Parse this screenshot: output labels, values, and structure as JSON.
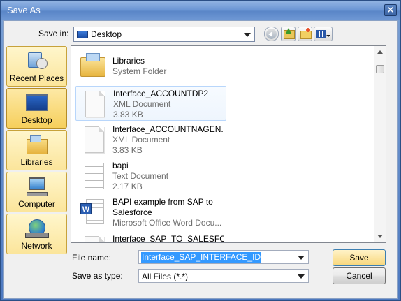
{
  "window": {
    "title": "Save As",
    "close_glyph": "✕"
  },
  "toolbar": {
    "save_in_label": "Save in:",
    "save_in_value": "Desktop",
    "back_icon": "back-arrow-icon",
    "up_icon": "up-folder-icon",
    "new_folder_icon": "new-folder-icon",
    "views_icon": "views-menu-icon"
  },
  "places": [
    {
      "label": "Recent Places",
      "icon": "recent-places-icon",
      "selected": false
    },
    {
      "label": "Desktop",
      "icon": "desktop-icon",
      "selected": true
    },
    {
      "label": "Libraries",
      "icon": "libraries-icon",
      "selected": false
    },
    {
      "label": "Computer",
      "icon": "computer-icon",
      "selected": false
    },
    {
      "label": "Network",
      "icon": "network-icon",
      "selected": false
    }
  ],
  "files": [
    {
      "name": "Libraries",
      "type": "System Folder",
      "size": "",
      "icon": "libraries-folder-icon"
    },
    {
      "name": "Interface_ACCOUNTDP2",
      "type": "XML Document",
      "size": "3.83 KB",
      "icon": "xml-document-icon"
    },
    {
      "name": "Interface_ACCOUNTNAGEN...",
      "type": "XML Document",
      "size": "3.83 KB",
      "icon": "xml-document-icon"
    },
    {
      "name": "bapi",
      "type": "Text Document",
      "size": "2.17 KB",
      "icon": "text-document-icon"
    },
    {
      "name": "BAPI example from SAP to Salesforce",
      "type": "Microsoft Office Word Docu...",
      "size": "",
      "icon": "word-document-icon"
    },
    {
      "name": "Interface_SAP_TO_SALESFO...",
      "type": "",
      "size": "",
      "icon": "xml-document-icon"
    }
  ],
  "form": {
    "file_name_label": "File name:",
    "file_name_value": "Interface_SAP_INTERFACE_ID",
    "save_as_type_label": "Save as type:",
    "save_as_type_value": "All Files (*.*)"
  },
  "buttons": {
    "save": "Save",
    "cancel": "Cancel"
  }
}
